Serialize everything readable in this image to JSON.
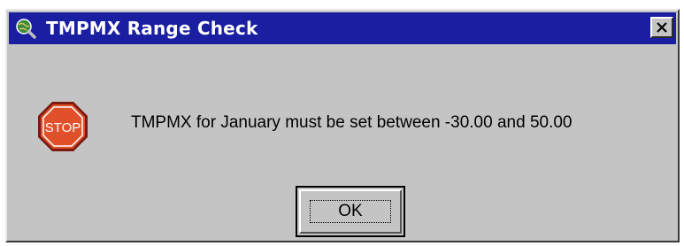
{
  "window": {
    "title": "TMPMX Range Check",
    "title_icon": "globe-magnifier-icon",
    "close_icon": "close-icon",
    "titlebar_color": "#1a1ea0",
    "body_color": "#c4c4c4"
  },
  "dialog": {
    "icon": "stop-sign-icon",
    "icon_text": "STOP",
    "icon_color": "#e0502a",
    "message": "TMPMX for January must be set between -30.00 and 50.00",
    "ok_label": "OK"
  }
}
